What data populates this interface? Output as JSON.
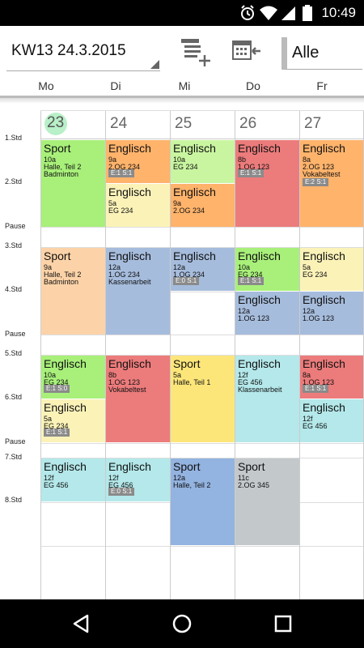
{
  "statusbar": {
    "time": "10:49",
    "icons": [
      "alarm-icon",
      "wifi-icon",
      "signal-icon",
      "battery-icon"
    ]
  },
  "toolbar": {
    "week_label": "KW13  24.3.2015",
    "add_lesson_icon": "add-lesson-icon",
    "calendar_icon": "calendar-import-icon",
    "filter_value": "Alle"
  },
  "days": [
    "Mo",
    "Di",
    "Mi",
    "Do",
    "Fr"
  ],
  "dates": [
    "23",
    "24",
    "25",
    "26",
    "27"
  ],
  "today_index": 0,
  "slots": [
    "1.Std",
    "2.Std",
    "Pause",
    "3.Std",
    "4.Std",
    "Pause",
    "5.Std",
    "6.Std",
    "Pause",
    "7.Std",
    "8.Std"
  ],
  "colors": {
    "green": "#a8f07a",
    "light_green": "#c9f5a0",
    "orange": "#ffb36b",
    "light_orange": "#fcd3a8",
    "yellow_pale": "#fbf2b8",
    "yellow": "#fce67a",
    "red": "#ec7b7b",
    "blue": "#a6bcdc",
    "blue_strong": "#93b3e0",
    "cyan": "#b4e8ea",
    "grey": "#c3c8cb"
  },
  "lessons": [
    {
      "day": "Mo",
      "subject": "Sport",
      "line1": "10a",
      "line2": "Halle, Teil 2",
      "line3": "Badminton",
      "tag": ""
    },
    {
      "day": "Di",
      "subject": "Englisch",
      "line1": "9a",
      "line2": "2.OG 234",
      "line3": "",
      "tag": "E:1  S:1"
    },
    {
      "day": "Di",
      "subject": "Englisch",
      "line1": "5a",
      "line2": "EG 234",
      "line3": "",
      "tag": ""
    },
    {
      "day": "Mi",
      "subject": "Englisch",
      "line1": "10a",
      "line2": "EG 234",
      "line3": "",
      "tag": ""
    },
    {
      "day": "Mi",
      "subject": "Englisch",
      "line1": "9a",
      "line2": "2.OG 234",
      "line3": "",
      "tag": ""
    },
    {
      "day": "Do",
      "subject": "Englisch",
      "line1": "8b",
      "line2": "1.OG 123",
      "line3": "",
      "tag": "E:1  S:1"
    },
    {
      "day": "Fr",
      "subject": "Englisch",
      "line1": "8a",
      "line2": "2.OG 123",
      "line3": "Vokabeltest",
      "tag": "E:2  S:1"
    },
    {
      "day": "Mo",
      "subject": "Sport",
      "line1": "9a",
      "line2": "Halle, Teil 2",
      "line3": "Badminton",
      "tag": ""
    },
    {
      "day": "Di",
      "subject": "Englisch",
      "line1": "12a",
      "line2": "1.OG 234",
      "line3": "Kassenarbeit",
      "tag": ""
    },
    {
      "day": "Mi",
      "subject": "Englisch",
      "line1": "12a",
      "line2": "1.OG 234",
      "line3": "",
      "tag": "E:0  S:1"
    },
    {
      "day": "Do",
      "subject": "Englisch",
      "line1": "10a",
      "line2": "EG 234",
      "line3": "",
      "tag": "E:1  S:1"
    },
    {
      "day": "Do",
      "subject": "Englisch",
      "line1": "12a",
      "line2": "1.OG 123",
      "line3": "",
      "tag": ""
    },
    {
      "day": "Fr",
      "subject": "Englisch",
      "line1": "5a",
      "line2": "EG 234",
      "line3": "",
      "tag": ""
    },
    {
      "day": "Fr",
      "subject": "Englisch",
      "line1": "12a",
      "line2": "1.OG 123",
      "line3": "",
      "tag": ""
    },
    {
      "day": "Mo",
      "subject": "Englisch",
      "line1": "10a",
      "line2": "EG 234",
      "line3": "",
      "tag": "E:1  S:0"
    },
    {
      "day": "Mo",
      "subject": "Englisch",
      "line1": "5a",
      "line2": "EG 234",
      "line3": "",
      "tag": "E:1  S:1"
    },
    {
      "day": "Di",
      "subject": "Englisch",
      "line1": "8b",
      "line2": "1.OG 123",
      "line3": "Vokabeltest",
      "tag": ""
    },
    {
      "day": "Mi",
      "subject": "Sport",
      "line1": "5a",
      "line2": "Halle, Teil 1",
      "line3": "",
      "tag": ""
    },
    {
      "day": "Do",
      "subject": "Englisch",
      "line1": "12f",
      "line2": "EG 456",
      "line3": "Klassenarbeit",
      "tag": ""
    },
    {
      "day": "Fr",
      "subject": "Englisch",
      "line1": "8a",
      "line2": "1.OG 123",
      "line3": "",
      "tag": "E:1  S:1"
    },
    {
      "day": "Fr",
      "subject": "Englisch",
      "line1": "12f",
      "line2": "EG 456",
      "line3": "",
      "tag": ""
    },
    {
      "day": "Mo",
      "subject": "Englisch",
      "line1": "12f",
      "line2": "EG 456",
      "line3": "",
      "tag": ""
    },
    {
      "day": "Di",
      "subject": "Englisch",
      "line1": "12f",
      "line2": "EG 456",
      "line3": "",
      "tag": "E:0  S:1"
    },
    {
      "day": "Mi",
      "subject": "Sport",
      "line1": "12a",
      "line2": "Halle, Teil 2",
      "line3": "",
      "tag": ""
    },
    {
      "day": "Do",
      "subject": "Sport",
      "line1": "11c",
      "line2": "2.OG 345",
      "line3": "",
      "tag": ""
    }
  ],
  "navbar": {
    "back_icon": "back-triangle-icon",
    "home_icon": "home-circle-icon",
    "recents_icon": "recents-square-icon"
  }
}
